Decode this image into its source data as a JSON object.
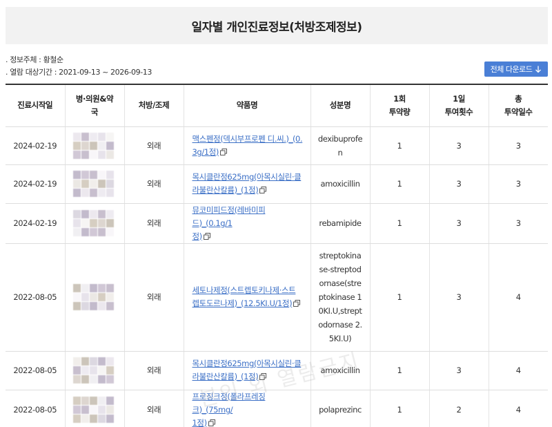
{
  "page": {
    "title": "일자별 개인진료정보(처방조제정보)"
  },
  "meta": {
    "subject_label": "정보주체 : 황철순",
    "period_label": "열람 대상기간 : 2021-09-13 ~ 2026-09-13"
  },
  "download_button": {
    "label": "전체 다운로드"
  },
  "table": {
    "headers": {
      "start_date": "진료시작일",
      "hospital_line1": "병·의원&약",
      "hospital_line2": "국",
      "rx_type": "처방/조제",
      "drug_name": "약품명",
      "component": "성분명",
      "dose_once_line1": "1회",
      "dose_once_line2": "투약량",
      "times_day_line1": "1일",
      "times_day_line2": "투여횟수",
      "total_days_line1": "총",
      "total_days_line2": "투약일수"
    },
    "rows": [
      {
        "date": "2024-02-19",
        "type": "외래",
        "drug_a": "맥스펜정(덱시부프로펜 디.씨.)_(0.",
        "drug_b": "3g/1정)",
        "comp": "dexibuprofen",
        "dose": "1",
        "times": "3",
        "days": "3"
      },
      {
        "date": "2024-02-19",
        "type": "외래",
        "drug_a": "목시클란정625mg(아목시실린·클",
        "drug_b": "라불란산칼륨)_(1정)",
        "comp": "amoxicillin",
        "dose": "1",
        "times": "3",
        "days": "3"
      },
      {
        "date": "2024-02-19",
        "type": "외래",
        "drug_a": "뮤코미피드정(레바미피드)_(0.1g/1",
        "drug_b": "정)",
        "comp": "rebamipide",
        "dose": "1",
        "times": "3",
        "days": "3"
      },
      {
        "date": "2022-08-05",
        "type": "외래",
        "drug_a": "세토나제정(스트렙토키나제·스트",
        "drug_b": "렙토도르나제)_(12.5KI.U/1정)",
        "comp": "streptokinase-streptodornase(streptokinase 10KI.U,streptodornase 2.5KI.U)",
        "dose": "1",
        "times": "3",
        "days": "4"
      },
      {
        "date": "2022-08-05",
        "type": "외래",
        "drug_a": "목시클란정625mg(아목시실린·클",
        "drug_b": "라불란산칼륨)_(1정)",
        "comp": "amoxicillin",
        "dose": "1",
        "times": "3",
        "days": "4"
      },
      {
        "date": "2022-08-05",
        "type": "외래",
        "drug_a": "프로징크정(폴라프레징크)_(75mg/",
        "drug_b": "1정)",
        "comp": "polaprezinc",
        "dose": "1",
        "times": "2",
        "days": "4"
      }
    ]
  },
  "watermark": {
    "text": "본인 외 열람금지"
  },
  "colors": {
    "accent": "#4a7fd6",
    "link": "#3b6fc6",
    "title_bg": "#f2f2f2"
  },
  "icons": {
    "download": "arrow-down-icon",
    "copy": "copy-icon"
  }
}
